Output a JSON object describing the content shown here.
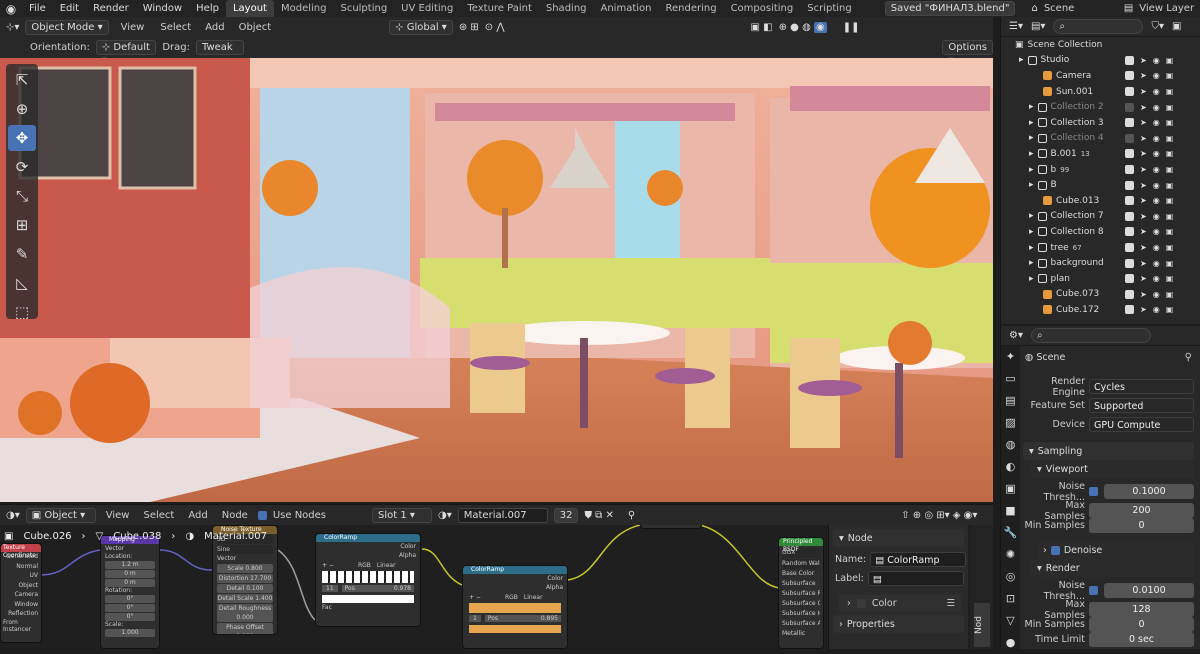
{
  "topbar": {
    "menus": [
      "File",
      "Edit",
      "Render",
      "Window",
      "Help"
    ],
    "workspaces": [
      "Layout",
      "Modeling",
      "Sculpting",
      "UV Editing",
      "Texture Paint",
      "Shading",
      "Animation",
      "Rendering",
      "Compositing",
      "Scripting"
    ],
    "saved": "Saved \"ФИНАЛ3.blend\"",
    "scene": "Scene",
    "view_layer": "View Layer"
  },
  "viewport": {
    "mode": "Object Mode",
    "menus": [
      "View",
      "Select",
      "Add",
      "Object"
    ],
    "orientation_label": "Orientation:",
    "orientation": "Default",
    "drag_label": "Drag:",
    "drag": "Tweak",
    "transform": "Global",
    "options": "Options"
  },
  "outliner": {
    "root": "Scene Collection",
    "rows": [
      {
        "name": "Studio",
        "indent": 0,
        "dim": false,
        "icon": "collection"
      },
      {
        "name": "Camera",
        "indent": 2,
        "dim": false,
        "icon": "camera"
      },
      {
        "name": "Sun.001",
        "indent": 2,
        "dim": false,
        "icon": "light"
      },
      {
        "name": "Collection 2",
        "indent": 1,
        "dim": true,
        "icon": "collection"
      },
      {
        "name": "Collection 3",
        "indent": 1,
        "dim": false,
        "icon": "collection"
      },
      {
        "name": "Collection 4",
        "indent": 1,
        "dim": true,
        "icon": "collection"
      },
      {
        "name": "B.001",
        "indent": 1,
        "dim": false,
        "icon": "collection",
        "badge": "13"
      },
      {
        "name": "b",
        "indent": 1,
        "dim": false,
        "icon": "collection",
        "badge": "99"
      },
      {
        "name": "B",
        "indent": 1,
        "dim": false,
        "icon": "collection"
      },
      {
        "name": "Cube.013",
        "indent": 2,
        "dim": false,
        "icon": "mesh"
      },
      {
        "name": "Collection 7",
        "indent": 1,
        "dim": false,
        "icon": "collection"
      },
      {
        "name": "Collection 8",
        "indent": 1,
        "dim": false,
        "icon": "collection"
      },
      {
        "name": "tree",
        "indent": 1,
        "dim": false,
        "icon": "collection",
        "badge": "67"
      },
      {
        "name": "background",
        "indent": 1,
        "dim": false,
        "icon": "collection"
      },
      {
        "name": "plan",
        "indent": 1,
        "dim": false,
        "icon": "collection"
      },
      {
        "name": "Cube.073",
        "indent": 2,
        "dim": false,
        "icon": "mesh"
      },
      {
        "name": "Cube.172",
        "indent": 2,
        "dim": false,
        "icon": "mesh"
      }
    ]
  },
  "properties": {
    "title": "Scene",
    "render_engine_label": "Render Engine",
    "render_engine": "Cycles",
    "feature_set_label": "Feature Set",
    "feature_set": "Supported",
    "device_label": "Device",
    "device": "GPU Compute",
    "sampling": "Sampling",
    "viewport": "Viewport",
    "noise_label": "Noise Thresh...",
    "viewport_noise": "0.1000",
    "max_samples_label": "Max Samples",
    "viewport_max": "200",
    "min_samples_label": "Min Samples",
    "viewport_min": "0",
    "denoise": "Denoise",
    "render": "Render",
    "render_noise": "0.0100",
    "render_max": "128",
    "render_min": "0",
    "time_limit_label": "Time Limit",
    "time_limit": "0 sec"
  },
  "node_editor": {
    "editor": "Object",
    "menus": [
      "View",
      "Select",
      "Add",
      "Node"
    ],
    "use_nodes": "Use Nodes",
    "slot": "Slot 1",
    "material": "Material.007",
    "users": "32",
    "breadcrumb": [
      "Cube.026",
      "Cube.038",
      "Material.007"
    ]
  },
  "node_panel": {
    "tab": "Node",
    "name_label": "Name:",
    "name": "ColorRamp",
    "label_label": "Label:",
    "color": "Color",
    "properties": "Properties",
    "side_tabs": [
      "Nod"
    ]
  },
  "nodes": {
    "texcoord": {
      "title": "Texture Coordinate",
      "outs": [
        "Generated",
        "Normal",
        "UV",
        "Object",
        "Camera",
        "Window",
        "Reflection"
      ],
      "extra": "From Instancer"
    },
    "mapping": {
      "title": "Mapping",
      "type": "Vector",
      "loc": "Location:",
      "x": "1.2 m",
      "y": "0 m",
      "z": "0 m",
      "rot": "Rotation:",
      "rx": "0°",
      "ry": "0°",
      "rz": "0°",
      "scale": "Scale:",
      "sx": "1.000"
    },
    "noise": {
      "title": "Noise Texture",
      "dim": "3D",
      "kind": "Sine",
      "vec": "Vector",
      "rows": [
        "Scale 0.800",
        "Distortion 17.700",
        "Detail 0.100",
        "Detail Scale 1.400",
        "Detail Roughness 0.000",
        "Phase Offset 0.000"
      ]
    },
    "ramp1": {
      "title": "ColorRamp",
      "outs": [
        "Color",
        "Alpha"
      ],
      "mode": "RGB",
      "interp": "Linear",
      "idx": "11",
      "pos_label": "Pos",
      "pos": "0.978",
      "fac": "Fac"
    },
    "ramp2": {
      "title": "ColorRamp",
      "outs": [
        "Color",
        "Alpha"
      ],
      "mode": "RGB",
      "interp": "Linear",
      "idx": "1",
      "pos_label": "Pos",
      "pos": "0.895"
    },
    "principled": {
      "title": "Principled BSDF",
      "rows": [
        "GGX",
        "Random Walk",
        "Base Color",
        "Subsurface",
        "Subsurface Radius",
        "Subsurface Color",
        "Subsurface IOR",
        "Subsurface Anisotropy",
        "Metallic"
      ]
    }
  }
}
